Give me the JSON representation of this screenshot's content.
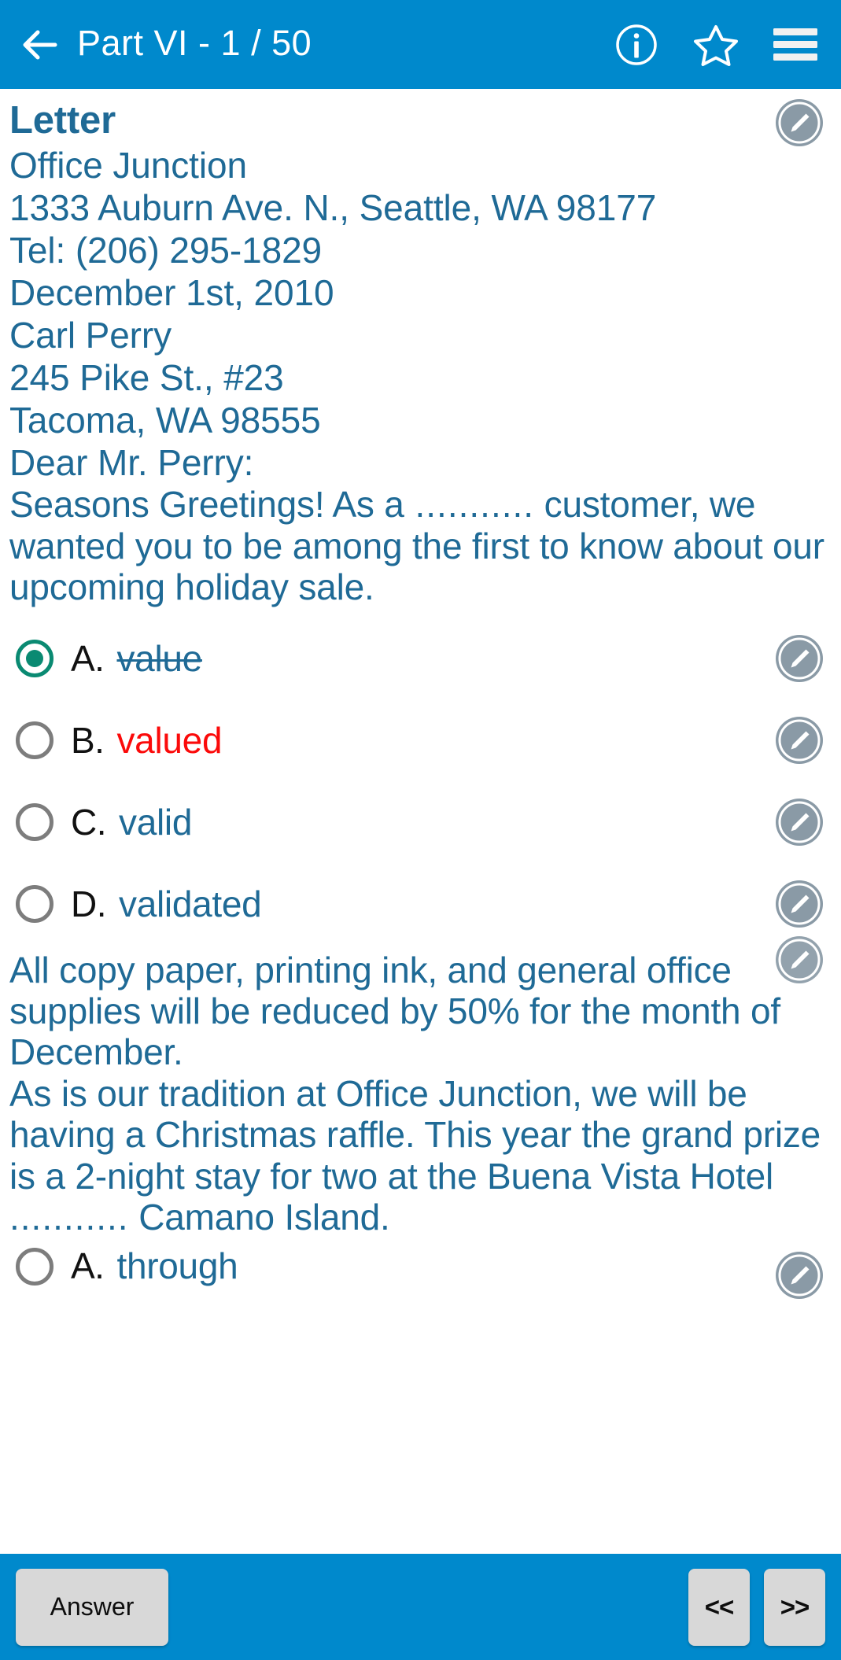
{
  "header": {
    "back_icon": "arrow-left-icon",
    "title": "Part VI  -  1 / 50",
    "info_icon": "info-circle-icon",
    "star_icon": "star-outline-icon",
    "menu_icon": "hamburger-menu-icon"
  },
  "document": {
    "title": "Letter",
    "lines": [
      "Office Junction",
      "1333 Auburn Ave. N., Seattle, WA 98177",
      "Tel: (206) 295-1829",
      "December 1st, 2010",
      "Carl Perry",
      "245 Pike St., #23",
      "Tacoma, WA 98555",
      "Dear Mr. Perry:"
    ]
  },
  "question1": {
    "prompt_before": "Seasons Greetings! As a",
    "blank": "...........",
    "prompt_after": "customer, we wanted you to be among the first to know about our upcoming holiday sale.",
    "options": [
      {
        "letter": "A.",
        "text": "value",
        "selected": true,
        "state": "struck"
      },
      {
        "letter": "B.",
        "text": "valued",
        "selected": false,
        "state": "wrong"
      },
      {
        "letter": "C.",
        "text": "valid",
        "selected": false,
        "state": "normal"
      },
      {
        "letter": "D.",
        "text": "validated",
        "selected": false,
        "state": "normal"
      }
    ],
    "edit_icon": "pencil-edit-icon"
  },
  "body": {
    "paragraph1": "All copy paper, printing ink, and general office supplies will be reduced by 50% for the month of December.",
    "paragraph2_before": "As is our tradition at Office Junction, we will be having a Christmas raffle. This year the grand prize is a 2-night stay for two at the Buena Vista Hotel",
    "paragraph2_blank": "...........",
    "paragraph2_after": "Camano Island."
  },
  "question2": {
    "options": [
      {
        "letter": "A.",
        "text": "through",
        "selected": false
      }
    ]
  },
  "footer": {
    "answer_label": "Answer",
    "prev_label": "<<",
    "next_label": ">>"
  },
  "colors": {
    "brand_blue": "#0089cc",
    "text_blue": "#1f6a96",
    "wrong_red": "#fb0a0a",
    "selected_teal": "#0a8a72",
    "button_grey": "#d8d8d8"
  }
}
